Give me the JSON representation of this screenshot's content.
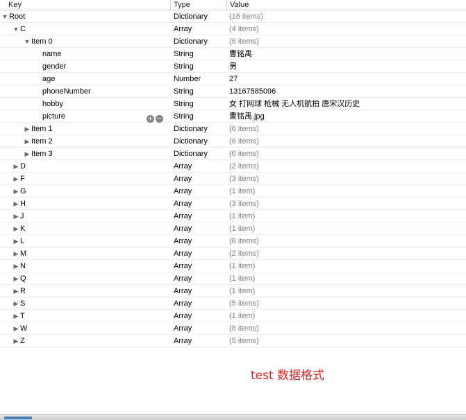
{
  "header": {
    "key": "Key",
    "type": "Type",
    "value": "Value"
  },
  "rows": [
    {
      "indent": 0,
      "toggle": "open",
      "key": "Root",
      "type": "Dictionary",
      "value": "(16 items)",
      "muted": true
    },
    {
      "indent": 1,
      "toggle": "open",
      "key": "C",
      "type": "Array",
      "value": "(4 items)",
      "muted": true
    },
    {
      "indent": 2,
      "toggle": "open",
      "key": "Item 0",
      "type": "Dictionary",
      "value": "(6 items)",
      "muted": true
    },
    {
      "indent": 3,
      "toggle": "none",
      "key": "name",
      "type": "String",
      "value": "曹铭禹",
      "muted": false
    },
    {
      "indent": 3,
      "toggle": "none",
      "key": "gender",
      "type": "String",
      "value": "男",
      "muted": false
    },
    {
      "indent": 3,
      "toggle": "none",
      "key": "age",
      "type": "Number",
      "value": "27",
      "muted": false
    },
    {
      "indent": 3,
      "toggle": "none",
      "key": "phoneNumber",
      "type": "String",
      "value": "13167585096",
      "muted": false
    },
    {
      "indent": 3,
      "toggle": "none",
      "key": "hobby",
      "type": "String",
      "value": "女  打网球  枪械  无人机航拍 唐宋汉历史",
      "muted": false
    },
    {
      "indent": 3,
      "toggle": "none",
      "key": "picture",
      "type": "String",
      "value": "曹铭禹.jpg",
      "muted": false,
      "controls": true
    },
    {
      "indent": 2,
      "toggle": "closed",
      "key": "Item 1",
      "type": "Dictionary",
      "value": "(6 items)",
      "muted": true
    },
    {
      "indent": 2,
      "toggle": "closed",
      "key": "Item 2",
      "type": "Dictionary",
      "value": "(6 items)",
      "muted": true
    },
    {
      "indent": 2,
      "toggle": "closed",
      "key": "Item 3",
      "type": "Dictionary",
      "value": "(6 items)",
      "muted": true
    },
    {
      "indent": 1,
      "toggle": "closed",
      "key": "D",
      "type": "Array",
      "value": "(2 items)",
      "muted": true
    },
    {
      "indent": 1,
      "toggle": "closed",
      "key": "F",
      "type": "Array",
      "value": "(3 items)",
      "muted": true
    },
    {
      "indent": 1,
      "toggle": "closed",
      "key": "G",
      "type": "Array",
      "value": "(1 item)",
      "muted": true
    },
    {
      "indent": 1,
      "toggle": "closed",
      "key": "H",
      "type": "Array",
      "value": "(3 items)",
      "muted": true
    },
    {
      "indent": 1,
      "toggle": "closed",
      "key": "J",
      "type": "Array",
      "value": "(1 item)",
      "muted": true
    },
    {
      "indent": 1,
      "toggle": "closed",
      "key": "K",
      "type": "Array",
      "value": "(1 item)",
      "muted": true
    },
    {
      "indent": 1,
      "toggle": "closed",
      "key": "L",
      "type": "Array",
      "value": "(8 items)",
      "muted": true
    },
    {
      "indent": 1,
      "toggle": "closed",
      "key": "M",
      "type": "Array",
      "value": "(2 items)",
      "muted": true
    },
    {
      "indent": 1,
      "toggle": "closed",
      "key": "N",
      "type": "Array",
      "value": "(1 item)",
      "muted": true
    },
    {
      "indent": 1,
      "toggle": "closed",
      "key": "Q",
      "type": "Array",
      "value": "(1 item)",
      "muted": true
    },
    {
      "indent": 1,
      "toggle": "closed",
      "key": "R",
      "type": "Array",
      "value": "(1 item)",
      "muted": true
    },
    {
      "indent": 1,
      "toggle": "closed",
      "key": "S",
      "type": "Array",
      "value": "(5 items)",
      "muted": true
    },
    {
      "indent": 1,
      "toggle": "closed",
      "key": "T",
      "type": "Array",
      "value": "(1 item)",
      "muted": true
    },
    {
      "indent": 1,
      "toggle": "closed",
      "key": "W",
      "type": "Array",
      "value": "(8 items)",
      "muted": true
    },
    {
      "indent": 1,
      "toggle": "closed",
      "key": "Z",
      "type": "Array",
      "value": "(5 items)",
      "muted": true
    }
  ],
  "row_controls": {
    "add": "+",
    "remove": "−"
  },
  "caption": "test 数据格式",
  "colors": {
    "caption": "#e0201f",
    "muted_value": "#7f7f7f"
  }
}
